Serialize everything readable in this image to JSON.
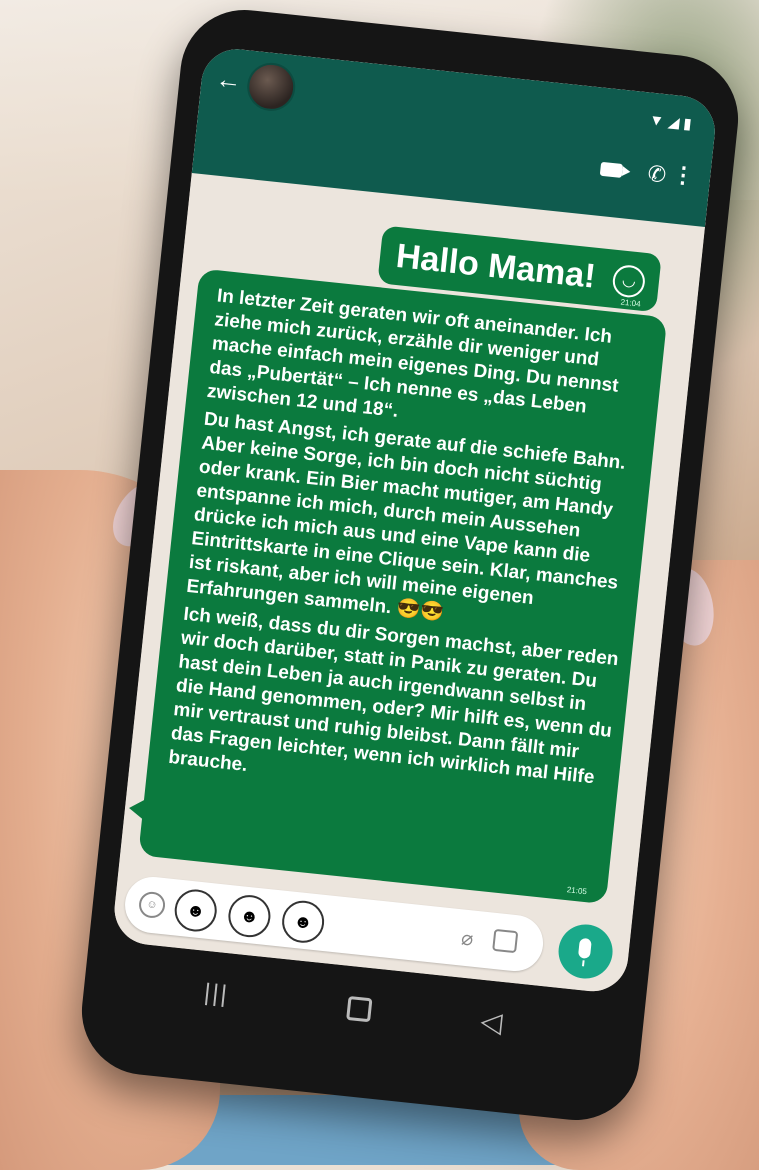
{
  "chat": {
    "messages": [
      {
        "text": "Hallo Mama!",
        "emoji": "grinning-face",
        "time": "21:04"
      },
      {
        "paragraphs": [
          "In letzter Zeit geraten wir oft aneinander. Ich ziehe mich zurück, erzähle dir weniger und mache einfach mein eigenes Ding. Du nennst das „Pubertät“ – Ich nenne es „das Leben zwischen 12 und 18“.",
          "Du hast Angst, ich gerate auf die schiefe Bahn. Aber keine Sorge, ich bin doch nicht süchtig oder krank. Ein Bier macht mutiger, am Handy entspanne ich mich, durch mein Aussehen drücke ich mich aus und eine Vape kann die Eintrittskarte in eine Clique sein. Klar, manches ist riskant, aber ich will meine eigenen Erfahrungen sammeln.",
          "Ich weiß, dass du dir Sorgen machst, aber reden wir doch darüber, statt in Panik zu geraten. Du hast dein Leben ja auch irgendwann selbst in die Hand genommen, oder? Mir hilft es, wenn du mir vertraust und ruhig bleibst. Dann fällt mir das Fragen leichter, wenn ich wirklich mal Hilfe brauche."
        ],
        "emoji": "sunglasses-face",
        "time": "21:05"
      }
    ]
  },
  "colors": {
    "header": "#0f5b4e",
    "bubble": "#0b7a3e",
    "mic": "#1aa98a"
  }
}
